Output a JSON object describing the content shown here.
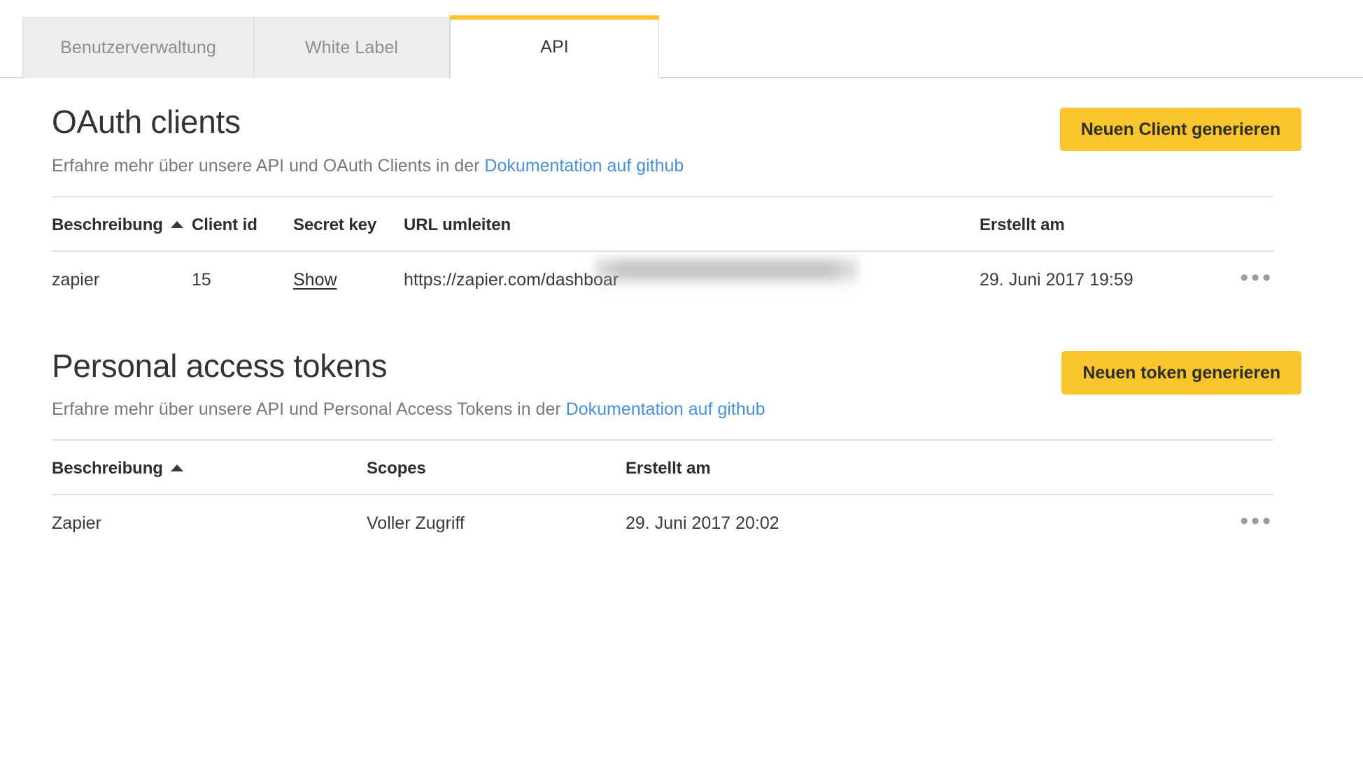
{
  "tabs": [
    {
      "label": "Benutzerverwaltung",
      "active": false
    },
    {
      "label": "White Label",
      "active": false
    },
    {
      "label": "API",
      "active": true
    }
  ],
  "colors": {
    "accent_yellow": "#f9c52b",
    "link_blue": "#4a90d9",
    "tab_inactive_bg": "#ededed",
    "divider": "#e2e2e2",
    "text": "#2e2e2e",
    "muted_text": "#787878"
  },
  "oauth_section": {
    "title": "OAuth clients",
    "subtitle_prefix": "Erfahre mehr über unsere API und OAuth Clients in der ",
    "subtitle_link": "Dokumentation auf github",
    "generate_button": "Neuen Client generieren",
    "columns": [
      "Beschreibung",
      "Client id",
      "Secret key",
      "URL umleiten",
      "Erstellt am",
      ""
    ],
    "sorted_column": "Beschreibung",
    "sort_direction": "ascending",
    "rows": [
      {
        "beschreibung": "zapier",
        "client_id": "15",
        "secret_key": "Show",
        "url_umleiten": "https://zapier.com/dashboar",
        "url_redacted": true,
        "erstellt_am": "29. Juni 2017 19:59",
        "actions": "•••"
      }
    ]
  },
  "pat_section": {
    "title": "Personal access tokens",
    "subtitle_prefix": "Erfahre mehr über unsere API und Personal Access Tokens in der ",
    "subtitle_link": "Dokumentation auf github",
    "generate_button": "Neuen token generieren",
    "columns": [
      "Beschreibung",
      "Scopes",
      "Erstellt am",
      ""
    ],
    "sorted_column": "Beschreibung",
    "sort_direction": "ascending",
    "rows": [
      {
        "beschreibung": "Zapier",
        "scopes": "Voller Zugriff",
        "erstellt_am": "29. Juni 2017 20:02",
        "actions": "•••"
      }
    ]
  }
}
